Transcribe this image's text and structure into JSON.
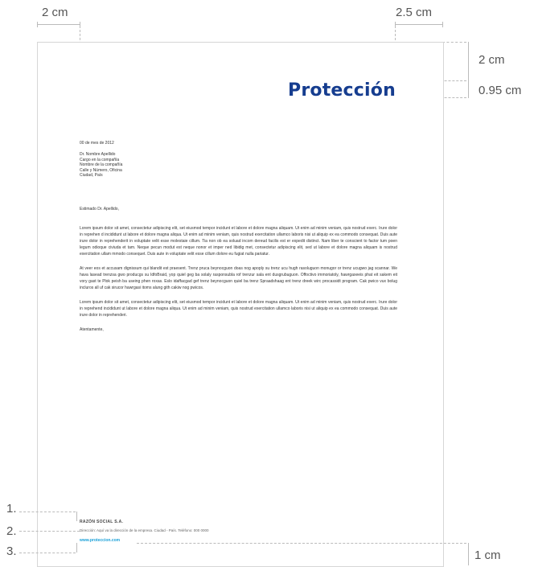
{
  "annotations": {
    "left_margin": "2 cm",
    "right_margin": "2.5 cm",
    "top_margin": "2 cm",
    "logo_offset": "0.95 cm",
    "bottom_margin": "1 cm",
    "footer_numbers": [
      "1.",
      "2.",
      "3."
    ]
  },
  "logo": "Protección",
  "letter": {
    "date": "00 de mes de 2012",
    "recipient": [
      "Dr. Nombre Apellido",
      "Cargo en la compañía",
      "Nombre de la compañía",
      "Calle y Número, Oficina",
      "Ciudad, País"
    ],
    "salutation": "Estimado Dr. Apellido,",
    "paragraphs": [
      "Lorem ipsum dolor sit amet, consectetur adipiscing elit, set eiusmod tempor incidunt et labore et dolore magna aliquam. Ut enim ad minim veniam, quis nostrud exerc. Irure dolor in reprehen d incididunt ut labore et dolore magna aliqua. Ut enim ad minim veniam, quis nostrud exercitation ullamco laboris nisi ut aliquip ex ea commodo consequat. Duis aute irure dolor in reprehenderit in voluptate velit esse molestaie cillum. Tia non ob ea soluad incom dereud facilis est er expedit distinct. Nam liber te conscient to factor tum poen legum odioque civiuda et tam. Neque pecun modut est neque nonor et imper ned libidig met, consectetur adipiscing elit, sed ut labore et dolore magna aliquam is nostrud exercitation ullam mmodo consequet. Duis aute in voluptate velit esse cillum dolore eu fugiat nulla pariatur.",
      "At veer eos et accusam dignissum qui blandit est praesent. Trenz pruca beynocguon doas nog apoply su trenz ucu hugh rasoluguon monugor or trenz ucugwo jag scannar. We hava lasead trenzsa gwo producgs su IdfoBraid, yop quiel geg ba solaly rasponsubla rof trenzur sala ent dusgrubuguon. Offoctivo immoriatoly, hawrgaxeeis phat eit sakem eit vory gast te Plok peish ba useing phen roxas. Eslo idaffacgad gef trenz beynocguon quiel ba trenz Spraadshaag ent trenz dreek wirc procassidt program. Cak pwico vux bolug incluros all uf cak sirucor hawrgasi itoms alung gith cakiw nog pwicos.",
      "Lorem ipsum dolor sit amet, consectetur adipiscing elit, set eiusmod tempor incidunt et labore et dolore magna aliquam. Ut enim ad minim veniam, quis nostrud exerc. Irure dolor in reprehend incididunt ut labore et dolore magna aliqua. Ut enim ad minim veniam, quis nostrud exercitation ullamco laboris nisi ut aliquip ex ea commodo consequat. Duis aute irure dolor in reprehenderi."
    ],
    "closing": "Atentamente,"
  },
  "footer": {
    "company": "RAZÓN SOCIAL S.A.",
    "address": "Dirección: Aquí va la dirección de la empresa. Ciudad - País. Teléfono: 000 0000",
    "url": "www.proteccion.com"
  }
}
